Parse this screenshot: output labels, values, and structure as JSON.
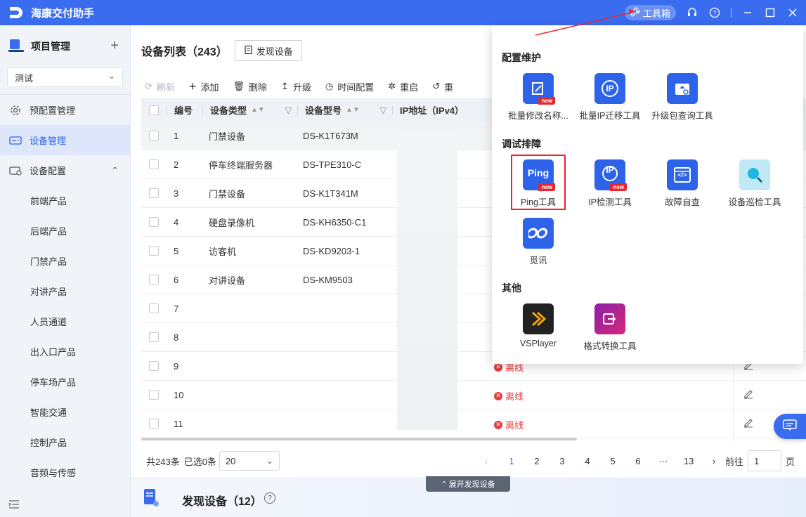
{
  "app": {
    "title": "海康交付助手",
    "toolbox_label": "工具箱"
  },
  "sidebar": {
    "project_title": "项目管理",
    "project_select": "测试",
    "items": [
      {
        "label": "预配置管理"
      },
      {
        "label": "设备管理"
      },
      {
        "label": "设备配置"
      }
    ],
    "sub_items": [
      "前端产品",
      "后端产品",
      "门禁产品",
      "对讲产品",
      "人员通道",
      "出入口产品",
      "停车场产品",
      "智能交通",
      "控制产品",
      "音频与传感"
    ]
  },
  "main": {
    "title": "设备列表（243）",
    "discover_btn": "发现设备",
    "toolbar": [
      "刷新",
      "添加",
      "删除",
      "升级",
      "时间配置",
      "重启",
      "重"
    ],
    "headers": {
      "no": "编号",
      "type": "设备类型",
      "model": "设备型号",
      "ip": "IP地址（IPv4）"
    },
    "rows": [
      {
        "no": "1",
        "type": "门禁设备",
        "model": "DS-K1T673M"
      },
      {
        "no": "2",
        "type": "停车终端服务器",
        "model": "DS-TPE310-C"
      },
      {
        "no": "3",
        "type": "门禁设备",
        "model": "DS-K1T341M"
      },
      {
        "no": "4",
        "type": "硬盘录像机",
        "model": "DS-KH6350-C1"
      },
      {
        "no": "5",
        "type": "访客机",
        "model": "DS-KD9203-1"
      },
      {
        "no": "6",
        "type": "对讲设备",
        "model": "DS-KM9503"
      },
      {
        "no": "7",
        "type": "",
        "model": ""
      },
      {
        "no": "8",
        "type": "",
        "model": ""
      },
      {
        "no": "9",
        "type": "",
        "model": ""
      },
      {
        "no": "10",
        "type": "",
        "model": ""
      },
      {
        "no": "11",
        "type": "",
        "model": ""
      }
    ],
    "status_offline": "离线"
  },
  "pager": {
    "total": "共243条",
    "selected": "已选0条",
    "page_size": "20",
    "pages": [
      "1",
      "2",
      "3",
      "4",
      "5",
      "6",
      "···",
      "13"
    ],
    "goto_label": "前往",
    "goto_value": "1",
    "page_unit": "页"
  },
  "bottom": {
    "title": "发现设备（12）",
    "expand": "展开发现设备"
  },
  "toolbox": {
    "sections": {
      "config": "配置维护",
      "debug": "调试排障",
      "other": "其他"
    },
    "config_tools": [
      {
        "label": "批量修改名称...",
        "new": "new"
      },
      {
        "label": "批量IP迁移工具",
        "glyph": "IP"
      },
      {
        "label": "升级包查询工具"
      }
    ],
    "debug_tools": [
      {
        "label": "Ping工具",
        "glyph": "Ping",
        "new": "new"
      },
      {
        "label": "IP检测工具",
        "glyph": "IP",
        "new": "new"
      },
      {
        "label": "故障自查",
        "glyph": "</>"
      },
      {
        "label": "设备巡检工具"
      },
      {
        "label": "觅讯"
      }
    ],
    "other_tools": [
      {
        "label": "VSPlayer"
      },
      {
        "label": "格式转换工具"
      }
    ]
  },
  "colors": {
    "brand": "#3a6cf0",
    "offline": "#e63d3d",
    "highlight": "#e8262d"
  }
}
